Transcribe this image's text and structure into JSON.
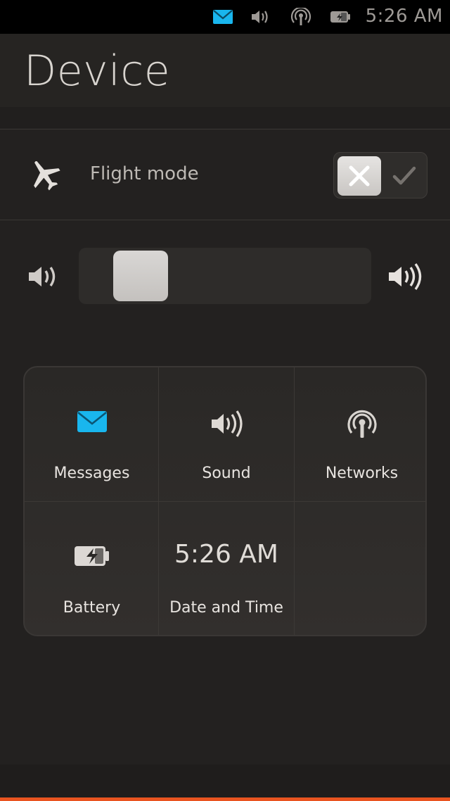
{
  "status_bar": {
    "time": "5:26 AM",
    "icons": [
      "envelope-icon",
      "speaker-icon",
      "network-icon",
      "battery-charging-icon"
    ],
    "envelope_color": "#19b6ee"
  },
  "header": {
    "title": "Device"
  },
  "flight_mode": {
    "label": "Flight mode",
    "enabled": false
  },
  "volume": {
    "level": 0.05
  },
  "grid": {
    "items": [
      {
        "label": "Messages",
        "icon": "envelope-icon"
      },
      {
        "label": "Sound",
        "icon": "speaker-icon"
      },
      {
        "label": "Networks",
        "icon": "network-icon"
      },
      {
        "label": "Battery",
        "icon": "battery-charging-icon"
      },
      {
        "label": "Date and Time",
        "value": "5:26 AM"
      }
    ]
  },
  "colors": {
    "accent": "#e95420",
    "background": "#232120"
  }
}
